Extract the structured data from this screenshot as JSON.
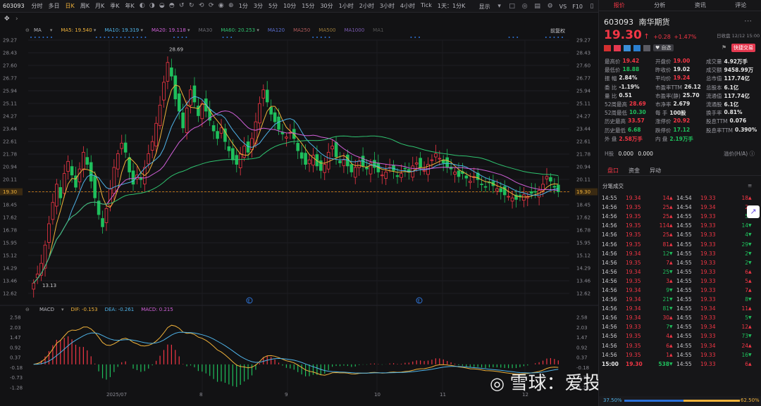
{
  "toolbar": {
    "code": "603093",
    "periods": [
      "分时",
      "多日",
      "日K",
      "周K",
      "月K",
      "季K",
      "年K",
      "1分",
      "3分",
      "5分",
      "10分",
      "15分",
      "30分",
      "1小时",
      "2小时",
      "3小时",
      "4小时",
      "Tick",
      "1天：1分K"
    ],
    "active_period": "日K",
    "display_label": "显示",
    "vs_label": "VS",
    "f10_label": "F10"
  },
  "ma_legend": {
    "ma_label": "MA",
    "items": [
      {
        "label": "MA5:",
        "value": "19.540",
        "color": "#f0b23a"
      },
      {
        "label": "MA10:",
        "value": "19.319",
        "color": "#4fb3e8"
      },
      {
        "label": "MA20:",
        "value": "19.118",
        "color": "#d060d8"
      },
      {
        "label": "MA30",
        "value": "",
        "color": "#6a6a72"
      },
      {
        "label": "MA60:",
        "value": "20.253",
        "color": "#2fc26f"
      },
      {
        "label": "MA120",
        "value": "",
        "color": "#5a6fd0"
      },
      {
        "label": "MA250",
        "value": "",
        "color": "#b05a5a"
      },
      {
        "label": "MA500",
        "value": "",
        "color": "#9a7a3a"
      },
      {
        "label": "MA1000",
        "value": "",
        "color": "#7a5ab0"
      },
      {
        "label": "MA1",
        "value": "",
        "color": "#555"
      }
    ],
    "adjust_label": "前复权"
  },
  "macd_legend": {
    "label": "MACD",
    "items": [
      {
        "label": "DIF:",
        "value": "-0.153",
        "color": "#f0b23a"
      },
      {
        "label": "DEA:",
        "value": "-0.261",
        "color": "#4fb3e8"
      },
      {
        "label": "MACD:",
        "value": "0.215",
        "color": "#d060d8"
      }
    ]
  },
  "price_axis": [
    "29.27",
    "28.43",
    "27.60",
    "26.77",
    "25.94",
    "25.11",
    "24.27",
    "23.44",
    "22.61",
    "21.78",
    "20.94",
    "20.11",
    "19.30",
    "18.45",
    "17.62",
    "16.78",
    "15.95",
    "15.12",
    "14.29",
    "13.46",
    "12.62"
  ],
  "macd_axis": [
    "2.58",
    "2.03",
    "1.47",
    "0.92",
    "0.37",
    "-0.18",
    "-0.73",
    "-1.28"
  ],
  "x_labels": [
    "2025/07",
    "8",
    "9",
    "10",
    "11",
    "12"
  ],
  "annotations": {
    "high": "28.69",
    "low": "13.13",
    "current": "19.30"
  },
  "watermark": "雪球：爱投资的小熊猫",
  "chart_data": {
    "type": "candlestick",
    "ylim": [
      12.62,
      29.27
    ],
    "close": [
      13.3,
      13.9,
      14.6,
      15.8,
      17.2,
      18.6,
      19.8,
      18.9,
      20.5,
      21.3,
      20.4,
      19.6,
      20.8,
      21.9,
      21.1,
      20.0,
      18.9,
      17.8,
      17.0,
      18.2,
      19.5,
      20.9,
      21.8,
      22.5,
      21.9,
      20.6,
      19.8,
      20.4,
      20.1,
      20.9,
      21.8,
      22.6,
      23.8,
      25.0,
      26.5,
      27.8,
      26.9,
      25.4,
      24.6,
      23.5,
      24.8,
      26.0,
      25.2,
      24.3,
      25.1,
      24.6,
      24.0,
      23.3,
      22.8,
      23.5,
      22.6,
      22.0,
      21.4,
      21.1,
      21.8,
      22.3,
      21.9,
      22.8,
      23.9,
      25.1,
      26.0,
      25.2,
      24.4,
      23.9,
      23.4,
      23.1,
      22.9,
      23.2,
      22.8,
      22.0,
      21.5,
      21.1,
      21.4,
      21.7,
      21.0,
      20.7,
      21.1,
      21.9,
      22.3,
      21.6,
      21.2,
      21.4,
      21.0,
      20.6,
      20.9,
      21.3,
      21.0,
      20.8,
      21.2,
      20.9,
      20.6,
      20.4,
      20.6,
      20.9,
      20.7,
      20.3,
      20.5,
      20.8,
      20.6,
      21.0,
      21.2,
      20.9,
      20.7,
      21.1,
      21.4,
      21.8,
      21.5,
      21.2,
      20.9,
      20.8,
      20.6,
      20.3,
      20.5,
      20.2,
      20.0,
      20.3,
      20.1,
      19.8,
      19.6,
      19.9,
      19.7,
      19.5,
      19.3,
      19.1,
      19.0,
      18.9,
      18.8,
      19.0,
      19.1,
      19.0,
      19.2,
      19.3,
      19.4,
      19.8,
      20.3,
      20.0,
      19.6,
      19.3
    ],
    "ma5": "computed",
    "ma10": "computed",
    "ma20": "computed",
    "ma60": "computed"
  },
  "panel": {
    "tabs": [
      "报价",
      "分析",
      "资讯",
      "评论"
    ],
    "active_tab": "报价",
    "code": "603093",
    "name": "南华期货",
    "price": "19.30",
    "arrow": "↑",
    "change": "+0.28",
    "change_pct": "+1.47%",
    "date_label": "日收盘 12/12 15:00",
    "self_select": "自选",
    "quick_trade": "快捷交易",
    "quotes": [
      [
        {
          "l": "最高价",
          "v": "19.42",
          "c": "red"
        },
        {
          "l": "开盘价",
          "v": "19.00",
          "c": "red"
        },
        {
          "l": "成交量",
          "v": "4.92万手",
          "c": "white"
        }
      ],
      [
        {
          "l": "最低价",
          "v": "18.88",
          "c": "green"
        },
        {
          "l": "昨收价",
          "v": "19.02",
          "c": "white"
        },
        {
          "l": "成交额",
          "v": "9458.99万",
          "c": "white"
        }
      ],
      [
        {
          "l": "振  幅",
          "v": "2.84%",
          "c": "white"
        },
        {
          "l": "平均价",
          "v": "19.24",
          "c": "red"
        },
        {
          "l": "总市值",
          "v": "117.74亿",
          "c": "white"
        }
      ],
      [
        {
          "l": "委  比",
          "v": "-1.19%",
          "c": "white"
        },
        {
          "l": "市盈率TTM",
          "v": "26.12",
          "c": "white"
        },
        {
          "l": "总股本",
          "v": "6.1亿",
          "c": "white"
        }
      ],
      [
        {
          "l": "量  比",
          "v": "0.51",
          "c": "white"
        },
        {
          "l": "市盈率(静)",
          "v": "25.70",
          "c": "white"
        },
        {
          "l": "流通值",
          "v": "117.74亿",
          "c": "white"
        }
      ],
      [
        {
          "l": "52周最高",
          "v": "28.69",
          "c": "red"
        },
        {
          "l": "市净率",
          "v": "2.679",
          "c": "white"
        },
        {
          "l": "流通股",
          "v": "6.1亿",
          "c": "white"
        }
      ],
      [
        {
          "l": "52周最低",
          "v": "10.30",
          "c": "green"
        },
        {
          "l": "每  手",
          "v": "100股",
          "c": "white"
        },
        {
          "l": "换手率",
          "v": "0.81%",
          "c": "white"
        }
      ],
      [
        {
          "l": "历史最高",
          "v": "33.57",
          "c": "red"
        },
        {
          "l": "涨停价",
          "v": "20.92",
          "c": "red"
        },
        {
          "l": "股息TTM",
          "v": "0.076",
          "c": "white"
        }
      ],
      [
        {
          "l": "历史最低",
          "v": "6.68",
          "c": "green"
        },
        {
          "l": "跌停价",
          "v": "17.12",
          "c": "green"
        },
        {
          "l": "股息率TTM",
          "v": "0.390%",
          "c": "white"
        }
      ],
      [
        {
          "l": "外  盘",
          "v": "2.58万手",
          "c": "red"
        },
        {
          "l": "内  盘",
          "v": "2.19万手",
          "c": "green"
        },
        {
          "l": "",
          "v": "",
          "c": "white"
        }
      ]
    ],
    "h_share": "H股",
    "h_values": [
      "0.000",
      "0.000"
    ],
    "premium": "溢价(H/A)",
    "sub_tabs": [
      "盘口",
      "资金",
      "异动"
    ],
    "active_sub": "盘口",
    "ticks_title": "分笔成交",
    "ticks": [
      [
        "14:55",
        "19.34",
        "14",
        "▲",
        "14:54",
        "19.33",
        "18",
        "▲"
      ],
      [
        "14:56",
        "19.35",
        "25",
        "▲",
        "14:54",
        "19.34",
        "2",
        "▲"
      ],
      [
        "14:56",
        "19.35",
        "25",
        "▲",
        "14:55",
        "19.33",
        "5",
        "▼"
      ],
      [
        "14:56",
        "19.35",
        "114",
        "▲",
        "14:55",
        "19.33",
        "14",
        "▼"
      ],
      [
        "14:56",
        "19.35",
        "25",
        "▲",
        "14:55",
        "19.33",
        "4",
        "▼"
      ],
      [
        "14:56",
        "19.35",
        "81",
        "▲",
        "14:55",
        "19.33",
        "29",
        "▼"
      ],
      [
        "14:56",
        "19.34",
        "12",
        "▼",
        "14:55",
        "19.33",
        "2",
        "▼"
      ],
      [
        "14:56",
        "19.35",
        "7",
        "▲",
        "14:55",
        "19.33",
        "2",
        "▼"
      ],
      [
        "14:56",
        "19.34",
        "25",
        "▼",
        "14:55",
        "19.33",
        "6",
        "▲"
      ],
      [
        "14:56",
        "19.35",
        "3",
        "▲",
        "14:55",
        "19.33",
        "5",
        "▲"
      ],
      [
        "14:56",
        "19.34",
        "9",
        "▼",
        "14:55",
        "19.33",
        "7",
        "▲"
      ],
      [
        "14:56",
        "19.34",
        "21",
        "▼",
        "14:55",
        "19.33",
        "8",
        "▼"
      ],
      [
        "14:56",
        "19.34",
        "81",
        "▼",
        "14:55",
        "19.34",
        "11",
        "▲"
      ],
      [
        "14:56",
        "19.34",
        "30",
        "▲",
        "14:55",
        "19.33",
        "5",
        "▼"
      ],
      [
        "14:56",
        "19.33",
        "7",
        "▼",
        "14:55",
        "19.34",
        "12",
        "▲"
      ],
      [
        "14:56",
        "19.35",
        "4",
        "▲",
        "14:55",
        "19.33",
        "73",
        "▼"
      ],
      [
        "14:56",
        "19.35",
        "6",
        "▲",
        "14:55",
        "19.34",
        "24",
        "▲"
      ],
      [
        "14:56",
        "19.35",
        "1",
        "▲",
        "14:55",
        "19.33",
        "16",
        "▼"
      ],
      [
        "15:00",
        "19.30",
        "538",
        "▼",
        "14:55",
        "19.33",
        "6",
        "▲"
      ]
    ],
    "ratio_left": "37.50%",
    "ratio_right": "62.50%"
  }
}
